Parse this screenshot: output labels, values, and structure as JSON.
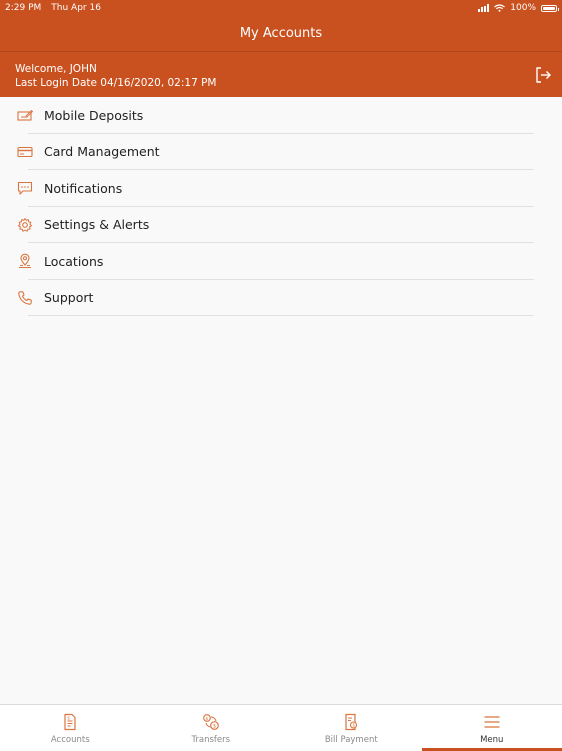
{
  "status_bar": {
    "time": "2:29 PM",
    "date": "Thu Apr 16",
    "battery": "100%",
    "battery_level": 1.0
  },
  "navbar": {
    "title": "My Accounts"
  },
  "welcome": {
    "greeting": "Welcome, JOHN",
    "last_login": "Last Login Date 04/16/2020, 02:17 PM"
  },
  "menu": {
    "items": [
      {
        "label": "Mobile Deposits",
        "icon": "check-deposit-icon"
      },
      {
        "label": "Card Management",
        "icon": "card-icon"
      },
      {
        "label": "Notifications",
        "icon": "chat-bubble-icon"
      },
      {
        "label": "Settings & Alerts",
        "icon": "gear-icon"
      },
      {
        "label": "Locations",
        "icon": "location-pin-icon"
      },
      {
        "label": "Support",
        "icon": "phone-icon"
      }
    ]
  },
  "tabbar": {
    "tabs": [
      {
        "label": "Accounts",
        "icon": "document-icon",
        "active": false
      },
      {
        "label": "Transfers",
        "icon": "transfer-icon",
        "active": false
      },
      {
        "label": "Bill Payment",
        "icon": "bill-icon",
        "active": false
      },
      {
        "label": "Menu",
        "icon": "hamburger-icon",
        "active": true
      }
    ]
  },
  "colors": {
    "brand": "#c9501f",
    "icon": "#d9753f",
    "background": "#f9f9f9",
    "divider": "#e1e1e1"
  }
}
